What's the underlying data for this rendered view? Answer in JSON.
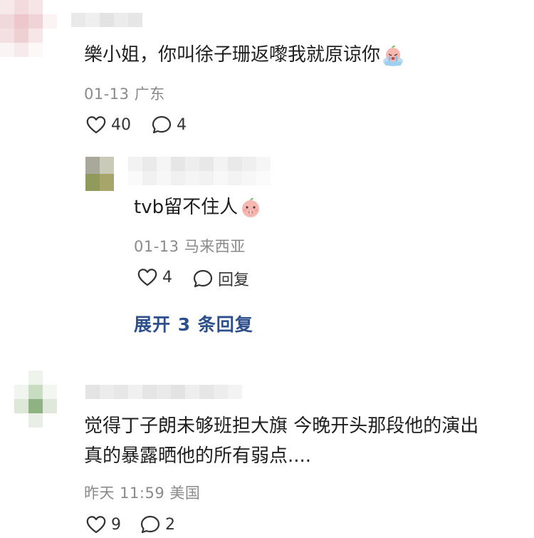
{
  "comments": [
    {
      "text": "樂小姐，你叫徐子珊返嚟我就原谅你",
      "emoji": "crying-peach-emoji",
      "date": "01-13",
      "location": "广东",
      "likes": "40",
      "replies": "4",
      "reply": {
        "text": "tvb留不住人",
        "emoji": "shush-peach-emoji",
        "date": "01-13",
        "location": "马来西亚",
        "likes": "4",
        "reply_label": "回复"
      },
      "expand_label": "展开 3 条回复"
    },
    {
      "text_line1": "觉得丁子朗未够班担大旗 今晚开头那段他的演出",
      "text_line2": "真的暴露晒他的所有弱点....",
      "date": "昨天 11:59",
      "location": "美国",
      "likes": "9",
      "replies": "2"
    }
  ],
  "colors": {
    "text": "#1e1e1e",
    "meta": "#8a8a8a",
    "link": "#2d4f8c",
    "emoji_peach": "#f6b8b0"
  }
}
